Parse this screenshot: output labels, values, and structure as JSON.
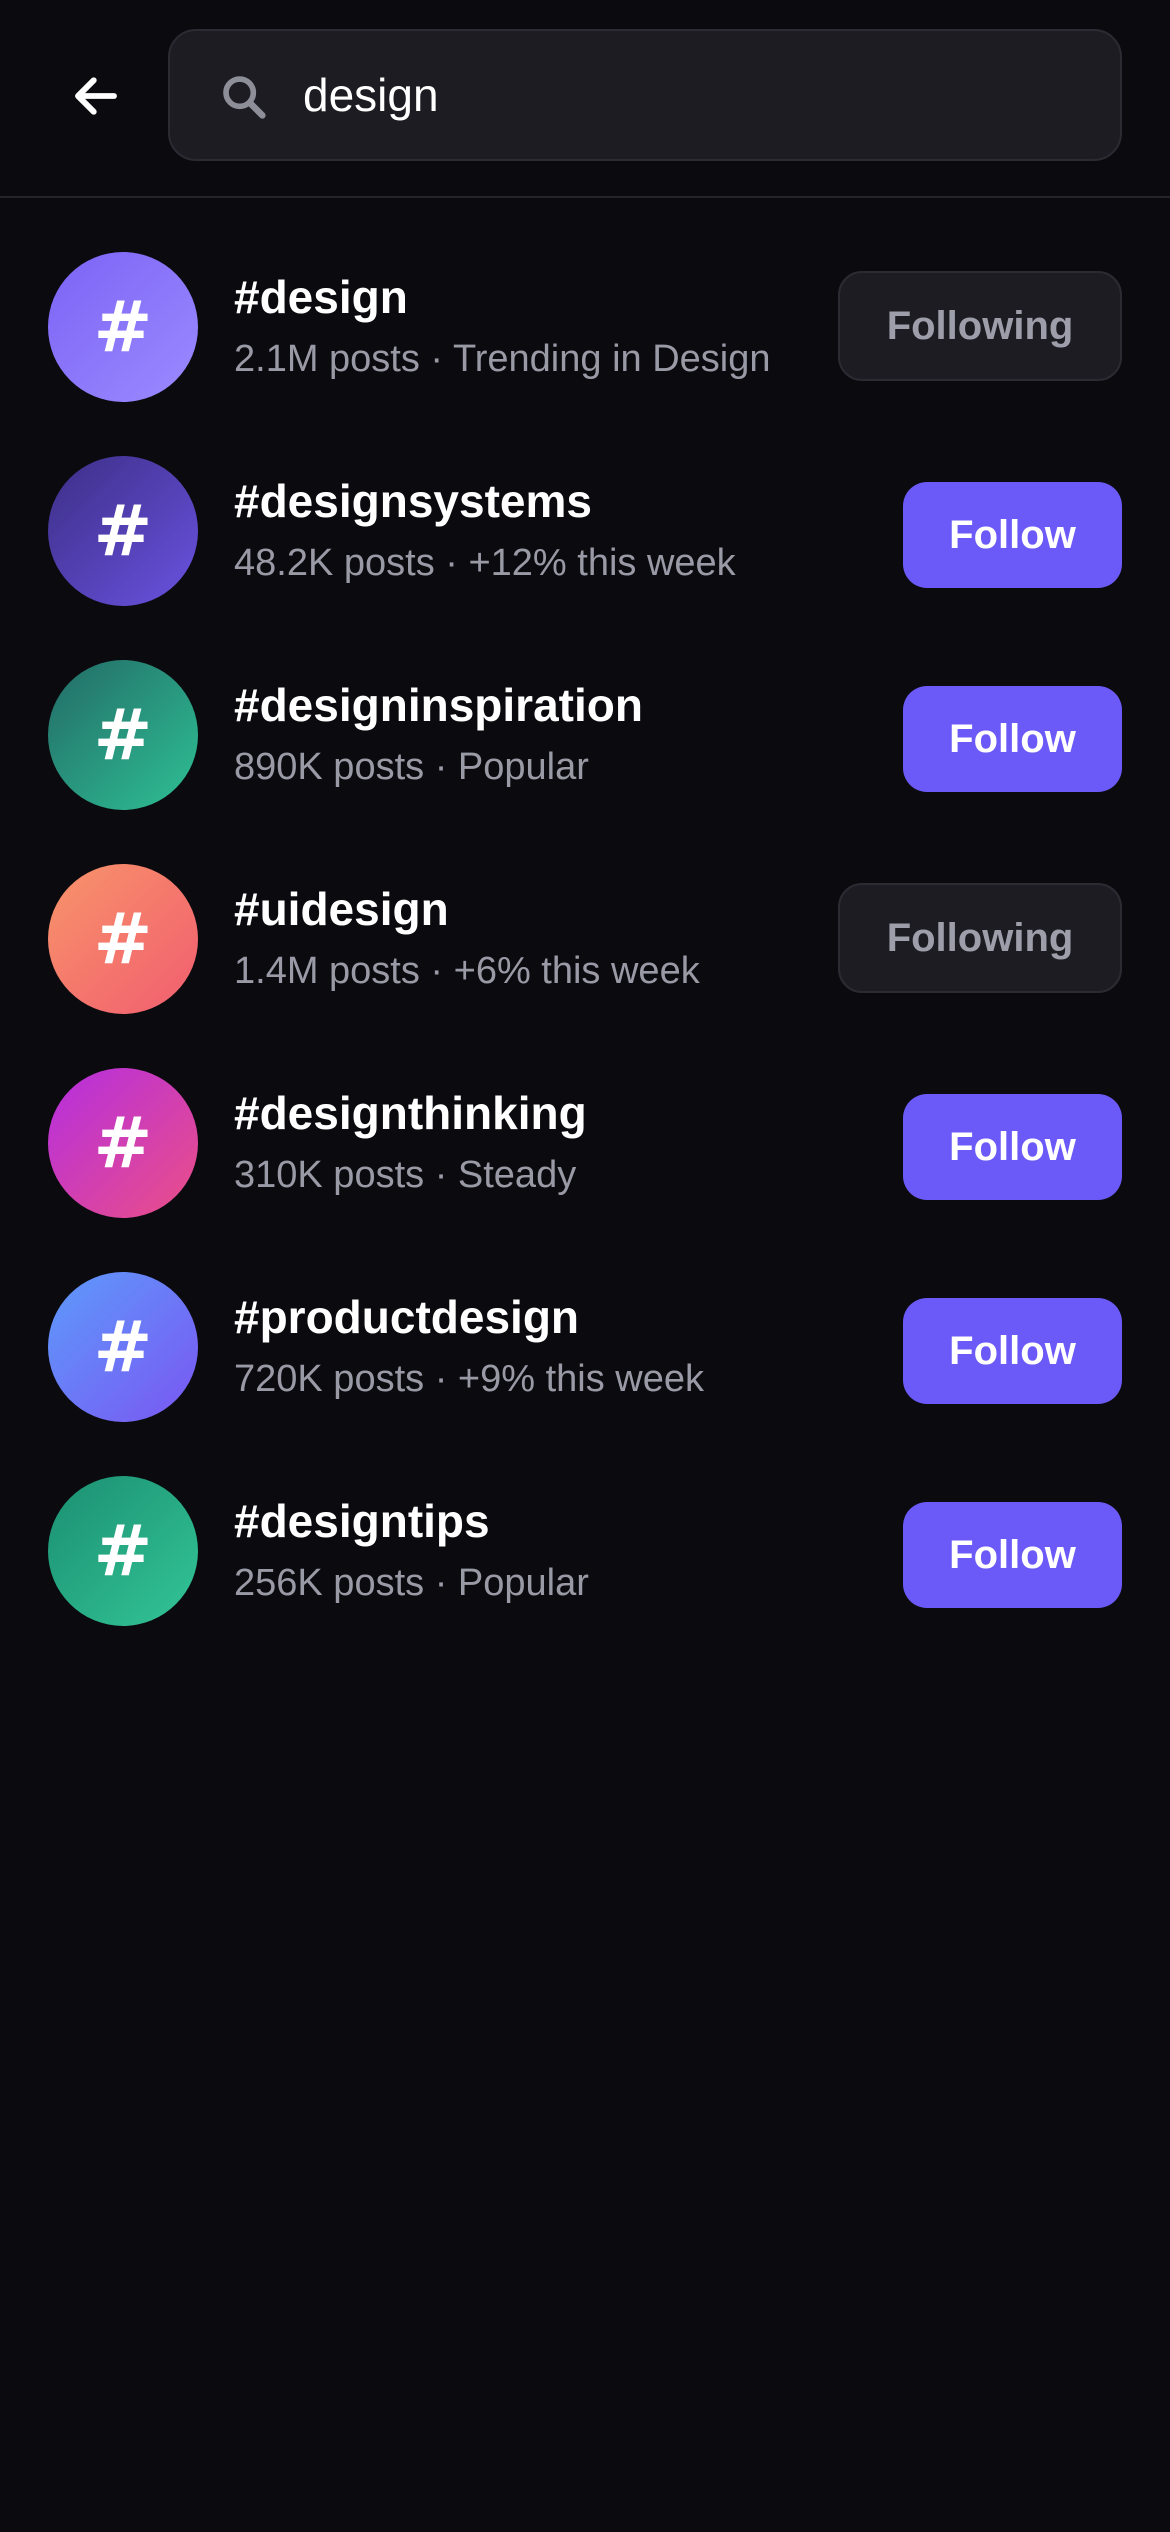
{
  "search": {
    "value": "design",
    "placeholder": "Search"
  },
  "results": [
    {
      "tag": "#design",
      "meta": "2.1M posts · Trending in Design",
      "symbol": "#",
      "button": "Following",
      "following": true,
      "gradient": [
        "#7c63f5",
        "#9a8bff"
      ]
    },
    {
      "tag": "#designsystems",
      "meta": "48.2K posts · +12% this week",
      "symbol": "#",
      "button": "Follow",
      "following": false,
      "gradient": [
        "#3c2f86",
        "#6a52e0"
      ]
    },
    {
      "tag": "#designinspiration",
      "meta": "890K posts · Popular",
      "symbol": "#",
      "button": "Follow",
      "following": false,
      "gradient": [
        "#236a66",
        "#2ec195"
      ]
    },
    {
      "tag": "#uidesign",
      "meta": "1.4M posts · +6% this week",
      "symbol": "#",
      "button": "Following",
      "following": true,
      "gradient": [
        "#f8946a",
        "#f15d6f"
      ]
    },
    {
      "tag": "#designthinking",
      "meta": "310K posts · Steady",
      "symbol": "#",
      "button": "Follow",
      "following": false,
      "gradient": [
        "#b42ee0",
        "#ec4f86"
      ]
    },
    {
      "tag": "#productdesign",
      "meta": "720K posts · +9% this week",
      "symbol": "#",
      "button": "Follow",
      "following": false,
      "gradient": [
        "#5d9bfb",
        "#7a56f2"
      ]
    },
    {
      "tag": "#designtips",
      "meta": "256K posts · Popular",
      "symbol": "#",
      "button": "Follow",
      "following": false,
      "gradient": [
        "#1b8f72",
        "#33c596"
      ]
    }
  ],
  "colors": {
    "background": "#0b0b0f",
    "accent": "#6b5af7",
    "muted_text": "#9a9aa6",
    "surface": "#1c1c22"
  },
  "icons": {
    "back": "arrow-left-icon",
    "search": "magnifier-icon"
  }
}
